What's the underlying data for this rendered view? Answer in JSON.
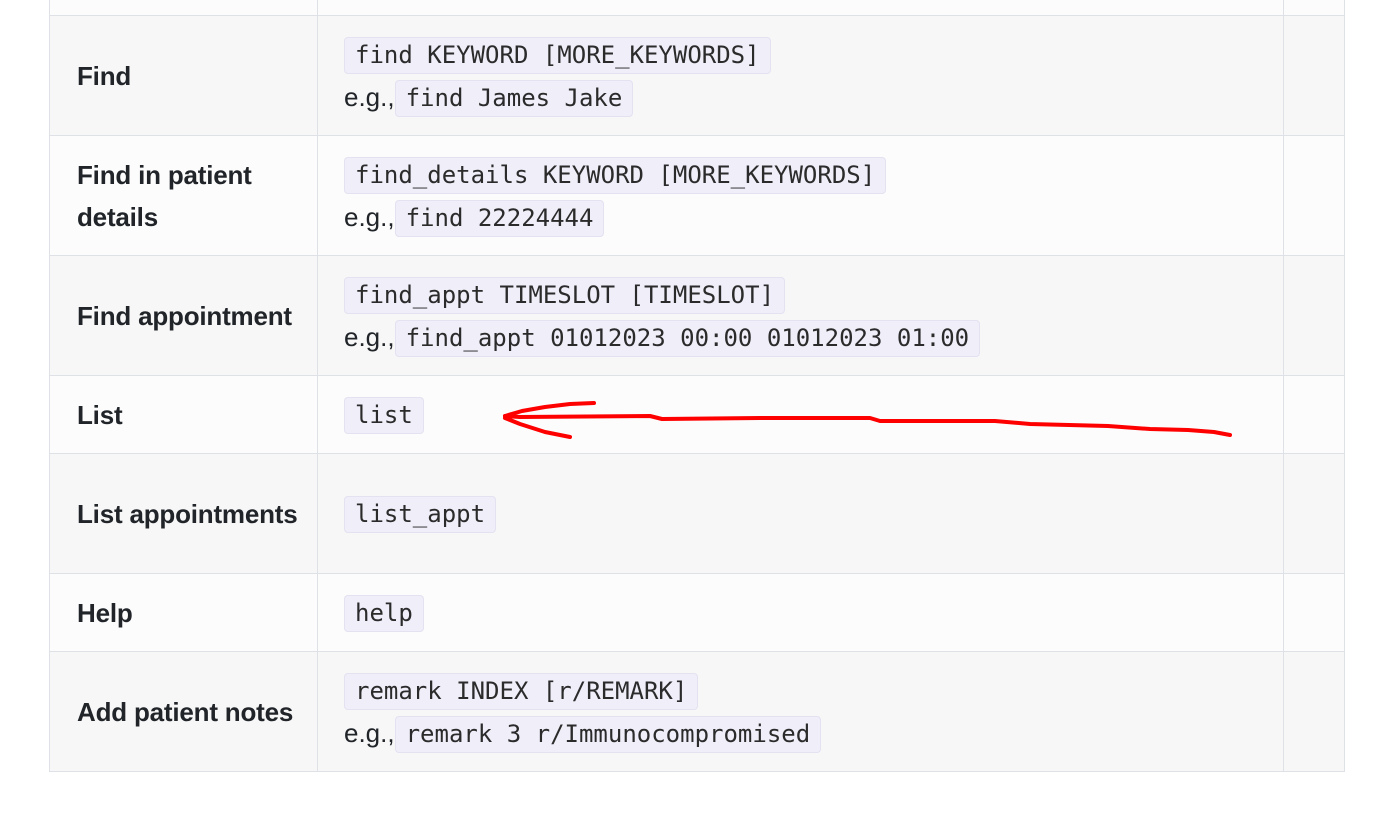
{
  "commands_table": {
    "rows": [
      {
        "action": "Find",
        "format": "find KEYWORD [MORE_KEYWORDS]",
        "example_prefix": "e.g.,",
        "example": "find James Jake"
      },
      {
        "action": "Find in patient details",
        "format": "find_details KEYWORD [MORE_KEYWORDS]",
        "example_prefix": "e.g.,",
        "example": "find 22224444"
      },
      {
        "action": "Find appointment",
        "format": "find_appt TIMESLOT [TIMESLOT]",
        "example_prefix": "e.g.,",
        "example": "find_appt 01012023 00:00 01012023 01:00"
      },
      {
        "action": "List",
        "format": "list"
      },
      {
        "action": "List appointments",
        "format": "list_appt"
      },
      {
        "action": "Help",
        "format": "help"
      },
      {
        "action": "Add patient notes",
        "format": "remark INDEX [r/REMARK]",
        "example_prefix": "e.g.,",
        "example": "remark 3 r/Immunocompromised"
      }
    ]
  },
  "annotation": {
    "arrow_color": "#ff0000",
    "arrow_points_to": "list"
  }
}
